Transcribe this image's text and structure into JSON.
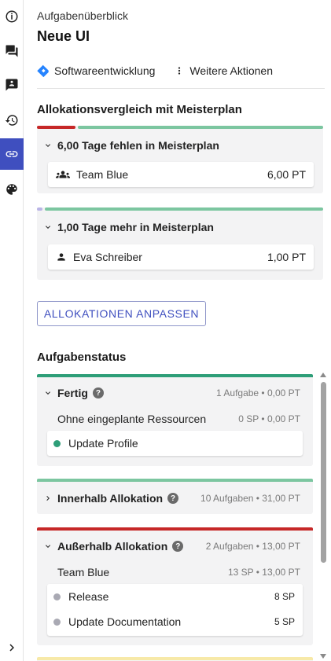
{
  "rail": {
    "items": [
      {
        "name": "info-icon",
        "active": false
      },
      {
        "name": "chat-icon",
        "active": false
      },
      {
        "name": "feedback-icon",
        "active": false
      },
      {
        "name": "history-icon",
        "active": false
      },
      {
        "name": "link-icon",
        "active": true
      },
      {
        "name": "palette-icon",
        "active": false
      }
    ],
    "expand_icon": "chevron-right-icon"
  },
  "header": {
    "breadcrumb": "Aufgabenüberblick",
    "title": "Neue UI"
  },
  "actions": {
    "project_label": "Softwareentwicklung",
    "more_label": "Weitere Aktionen"
  },
  "allocation": {
    "title": "Allokationsvergleich mit Meisterplan",
    "groups": [
      {
        "heading": "6,00 Tage fehlen in Meisterplan",
        "row": {
          "label": "Team Blue",
          "value": "6,00 PT",
          "icon": "team-icon"
        },
        "bar_colors": [
          "#c62828",
          "#7cc6a0"
        ]
      },
      {
        "heading": "1,00 Tage mehr in Meisterplan",
        "row": {
          "label": "Eva Schreiber",
          "value": "1,00 PT",
          "icon": "person-icon"
        },
        "bar_colors": [
          "#b9b4e6",
          "#7cc6a0"
        ]
      }
    ],
    "adjust_button": "ALLOKATIONEN ANPASSEN"
  },
  "status": {
    "title": "Aufgabenstatus",
    "groups": [
      {
        "label": "Fertig",
        "meta": "1 Aufgabe • 0,00 PT",
        "color": "#2e9e78",
        "sub": {
          "label": "Ohne eingeplante Ressourcen",
          "meta": "0 SP • 0,00 PT"
        },
        "tasks": [
          {
            "name": "Update Profile",
            "sp": "",
            "dot": "#2e9e78"
          }
        ]
      },
      {
        "label": "Innerhalb Allokation",
        "meta": "10 Aufgaben • 31,00 PT",
        "color": "#7cc6a0"
      },
      {
        "label": "Außerhalb Allokation",
        "meta": "2 Aufgaben • 13,00 PT",
        "color": "#c62828",
        "sub": {
          "label": "Team Blue",
          "meta": "13 SP • 13,00 PT"
        },
        "tasks": [
          {
            "name": "Release",
            "sp": "8 SP",
            "dot": "#a9a9b3"
          },
          {
            "name": "Update Documentation",
            "sp": "5 SP",
            "dot": "#a9a9b3"
          }
        ]
      }
    ],
    "next_group_color": "#f7e9a8"
  },
  "colors": {
    "accent": "#3f4fbf",
    "panel": "#f3f3f4"
  }
}
